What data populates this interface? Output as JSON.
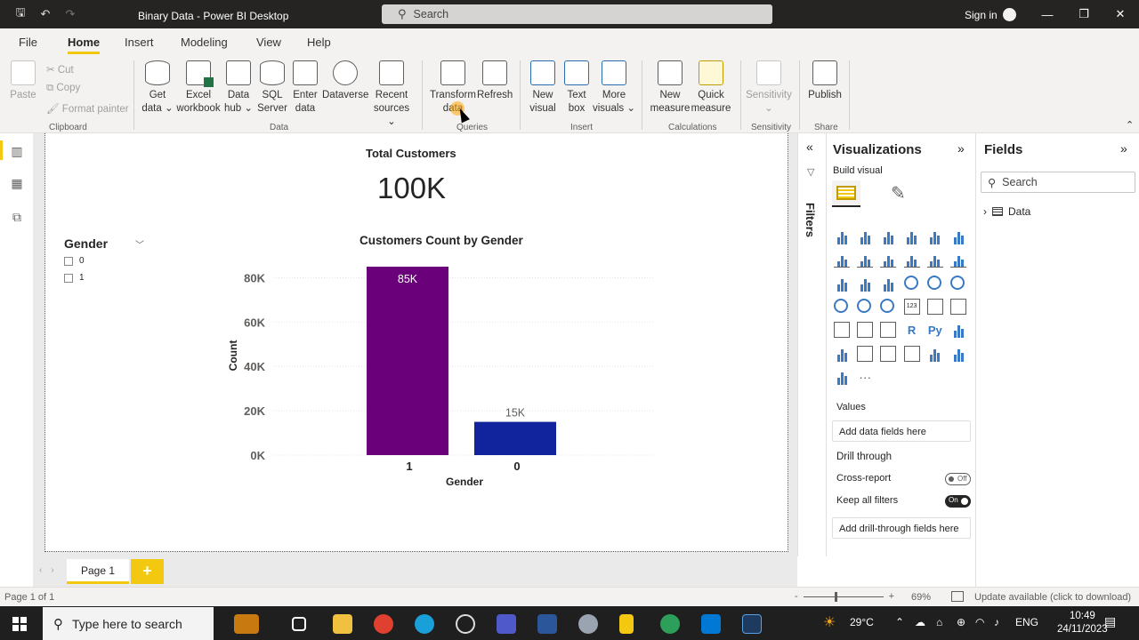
{
  "titlebar": {
    "title": "Binary Data - Power BI Desktop",
    "search_placeholder": "Search",
    "signin": "Sign in"
  },
  "menu": {
    "tabs": [
      "File",
      "Home",
      "Insert",
      "Modeling",
      "View",
      "Help"
    ],
    "active": "Home"
  },
  "ribbon": {
    "clipboard": {
      "paste": "Paste",
      "cut": "Cut",
      "copy": "Copy",
      "format_painter": "Format painter",
      "group": "Clipboard"
    },
    "data": {
      "get_data": [
        "Get",
        "data"
      ],
      "excel": [
        "Excel",
        "workbook"
      ],
      "data_hub": [
        "Data",
        "hub"
      ],
      "sql": [
        "SQL",
        "Server"
      ],
      "enter": [
        "Enter",
        "data"
      ],
      "dataverse": "Dataverse",
      "recent": [
        "Recent",
        "sources"
      ],
      "group": "Data"
    },
    "queries": {
      "transform": [
        "Transform",
        "data"
      ],
      "refresh": "Refresh",
      "group": "Queries"
    },
    "insert": {
      "new_visual": [
        "New",
        "visual"
      ],
      "text_box": [
        "Text",
        "box"
      ],
      "more_visuals": [
        "More",
        "visuals"
      ],
      "group": "Insert"
    },
    "calculations": {
      "new_measure": [
        "New",
        "measure"
      ],
      "quick_measure": [
        "Quick",
        "measure"
      ],
      "group": "Calculations"
    },
    "sensitivity": {
      "label": "Sensitivity",
      "group": "Sensitivity"
    },
    "share": {
      "publish": "Publish",
      "group": "Share"
    }
  },
  "report": {
    "card": {
      "label": "Total Customers",
      "value": "100K"
    },
    "slicer": {
      "title": "Gender",
      "items": [
        "0",
        "1"
      ]
    }
  },
  "chart_data": {
    "type": "bar",
    "title": "Customers Count by Gender",
    "xlabel": "Gender",
    "ylabel": "Count",
    "categories": [
      "1",
      "0"
    ],
    "values": [
      85000,
      15000
    ],
    "data_labels": [
      "85K",
      "15K"
    ],
    "ylim": [
      0,
      85000
    ],
    "yticks": [
      0,
      20000,
      40000,
      60000,
      80000
    ],
    "ytick_labels": [
      "0K",
      "20K",
      "40K",
      "60K",
      "80K"
    ],
    "colors": [
      "#6b007b",
      "#12239e"
    ],
    "grid": true
  },
  "pages": {
    "tabs": [
      "Page 1"
    ],
    "add": "+"
  },
  "status": {
    "page": "Page 1 of 1",
    "zoom": "69%",
    "zoom_fraction": 0.69,
    "update": "Update available (click to download)"
  },
  "filters": {
    "label": "Filters"
  },
  "visualizations": {
    "title": "Visualizations",
    "build": "Build visual",
    "values_label": "Values",
    "values_placeholder": "Add data fields here",
    "drill_title": "Drill through",
    "cross_report": "Cross-report",
    "cross_report_state": "Off",
    "keep_filters": "Keep all filters",
    "keep_filters_state": "On",
    "drill_placeholder": "Add drill-through fields here"
  },
  "fields": {
    "title": "Fields",
    "search_placeholder": "Search",
    "tables": [
      "Data"
    ]
  },
  "taskbar": {
    "search_placeholder": "Type here to search",
    "temperature": "29°C",
    "lang": "ENG",
    "time": "10:49",
    "date": "24/11/2023"
  }
}
